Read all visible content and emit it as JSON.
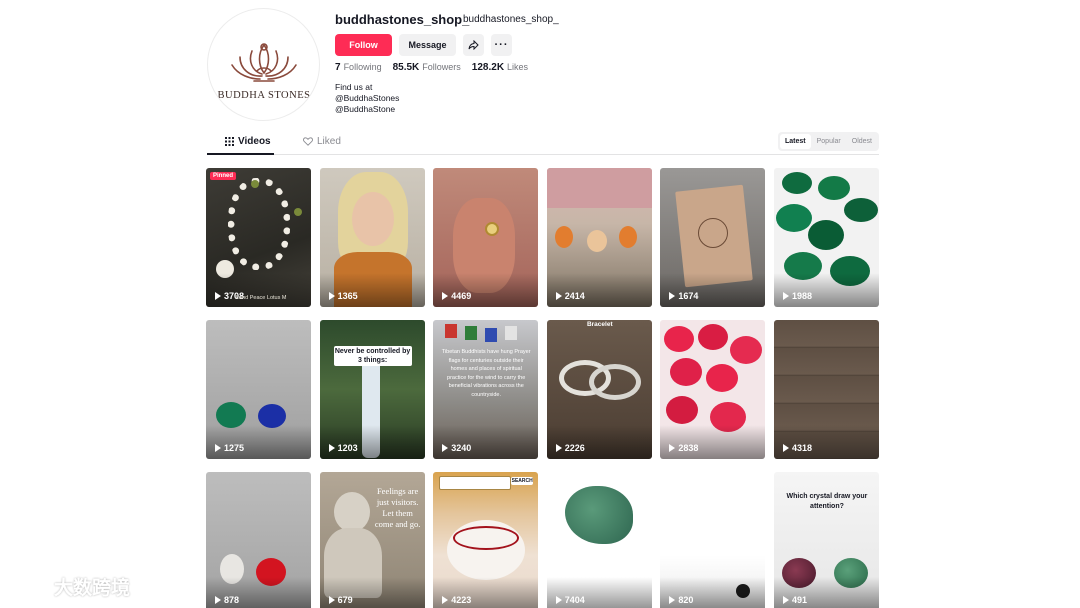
{
  "profile": {
    "logo_text": "BUDDHA STONES",
    "username": "buddhastones_shop_",
    "nickname": "buddhastones_shop_",
    "follow_label": "Follow",
    "message_label": "Message",
    "stats": [
      {
        "value": "7",
        "label": "Following"
      },
      {
        "value": "85.5K",
        "label": "Followers"
      },
      {
        "value": "128.2K",
        "label": "Likes"
      }
    ],
    "bio_lines": [
      "Find us at",
      "@BuddhaStones",
      "@BuddhaStone"
    ]
  },
  "tabs": {
    "videos_label": "Videos",
    "liked_label": "Liked",
    "sort_options": [
      "Latest",
      "Popular",
      "Oldest"
    ],
    "sort_selected": "Latest"
  },
  "videos": [
    {
      "views": "3708",
      "pinned_label": "Pinned",
      "caption": "Land Peace Lotus M"
    },
    {
      "views": "1365"
    },
    {
      "views": "4469"
    },
    {
      "views": "2414"
    },
    {
      "views": "1674"
    },
    {
      "views": "1988"
    },
    {
      "views": "1275"
    },
    {
      "views": "1203",
      "caption": "Never be controlled by 3 things:"
    },
    {
      "views": "3240",
      "caption": "Tibetan Buddhists have hung Prayer flags for centuries outside their homes and places of spiritual practice for the wind to carry the beneficial vibrations across the countryside."
    },
    {
      "views": "2226",
      "caption": "Bracelet"
    },
    {
      "views": "2838"
    },
    {
      "views": "4318"
    },
    {
      "views": "878"
    },
    {
      "views": "679",
      "caption": "Feelings are just visitors. Let them come and go."
    },
    {
      "views": "4223",
      "caption": "SEARCH"
    },
    {
      "views": "7404"
    },
    {
      "views": "820"
    },
    {
      "views": "491",
      "caption": "Which crystal draw your attention?"
    }
  ],
  "watermark": "大数跨境",
  "colors": {
    "accent": "#fe2c55",
    "text": "#161823",
    "muted": "#73747a"
  },
  "icons": [
    "grid-icon",
    "heart-outline-icon",
    "share-arrow-icon",
    "more-dots-icon",
    "play-icon"
  ]
}
